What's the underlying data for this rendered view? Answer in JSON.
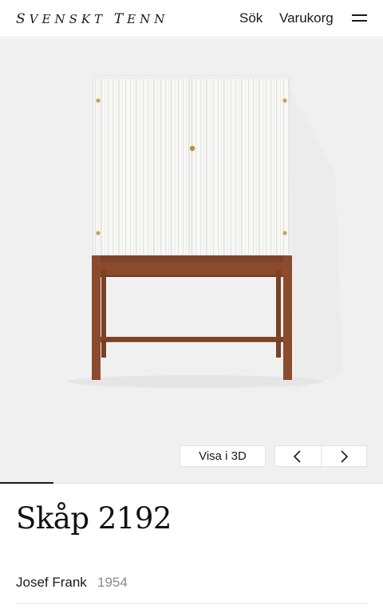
{
  "header": {
    "logo": "Svenskt Tenn",
    "search_label": "Sök",
    "cart_label": "Varukorg",
    "menu_icon": "hamburger-menu-icon"
  },
  "gallery": {
    "view_3d_label": "Visa i 3D",
    "prev_icon": "chevron-left-icon",
    "next_icon": "chevron-right-icon",
    "progress": 0.14
  },
  "product": {
    "title": "Skåp 2192",
    "designer": "Josef Frank",
    "year": "1954"
  },
  "colors": {
    "stage_background": "#f0f0f0",
    "cabinet_white": "#f7f7f5",
    "wood": "#8a4a2c",
    "brass": "#c9a24a"
  }
}
